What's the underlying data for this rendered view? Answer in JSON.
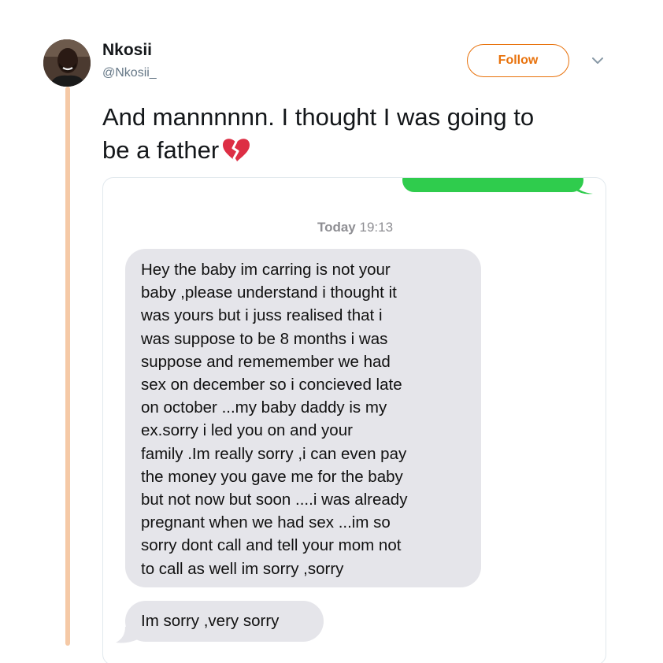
{
  "tweet": {
    "display_name": "Nkosii",
    "handle": "@Nkosii_",
    "follow_label": "Follow",
    "text": "And mannnnnn. I thought I was going to be a father",
    "text_lines": [
      "And mannnnnn. I thought I was going to",
      "be a father"
    ],
    "emoji": "broken-heart-icon",
    "accent_color": "#e8720c"
  },
  "conversation": {
    "timestamp_day": "Today",
    "timestamp_time": "19:13",
    "messages": [
      {
        "direction": "received",
        "lines": [
          "Hey the baby im carring is not your",
          "baby ,please understand i thought it",
          "was yours but i juss realised that i",
          "was suppose to be 8 months i was",
          "suppose and rememember we had",
          "sex on december so i concieved late",
          "on october ...my baby daddy is my",
          "ex.sorry i led you on and your",
          "family .Im really sorry ,i can even pay",
          "the money you gave me for the baby",
          "but not now but soon ....i was already",
          "pregnant when we had sex ...im so",
          "sorry dont call and tell your mom not",
          "to call as well im sorry ,sorry"
        ]
      },
      {
        "direction": "received",
        "text": "Im sorry ,very sorry"
      }
    ],
    "sent_bubble_color": "#2fcc4d",
    "received_bubble_color": "#e5e5ea"
  }
}
